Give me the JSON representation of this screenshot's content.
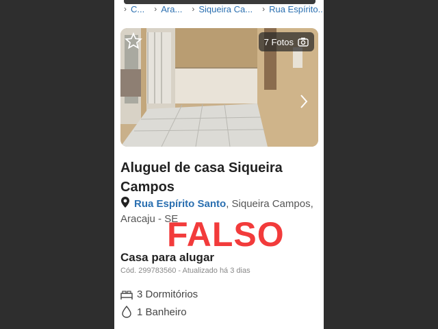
{
  "breadcrumb": [
    "C...",
    "Ara...",
    "Siqueira Ca...",
    "Rua Espírito..."
  ],
  "photo": {
    "count_label": "7 Fotos"
  },
  "listing": {
    "title": "Aluguel de casa Siqueira Campos",
    "street": "Rua Espírito Santo",
    "locality_line1": ", Siqueira Campos,",
    "locality_line2": "Aracaju - SE",
    "type": "Casa para alugar",
    "code_info": "Cód. 299783560 - Atualizado há 3 dias",
    "bedrooms": "3 Dormitórios",
    "bathrooms": "1 Banheiro"
  },
  "overlay": {
    "stamp": "FALSO"
  },
  "colors": {
    "link": "#2a6fb0",
    "stamp": "#f23b3b"
  },
  "icons": [
    "star-icon",
    "camera-icon",
    "chevron-right-icon",
    "location-pin-icon",
    "bed-icon",
    "drop-icon"
  ]
}
